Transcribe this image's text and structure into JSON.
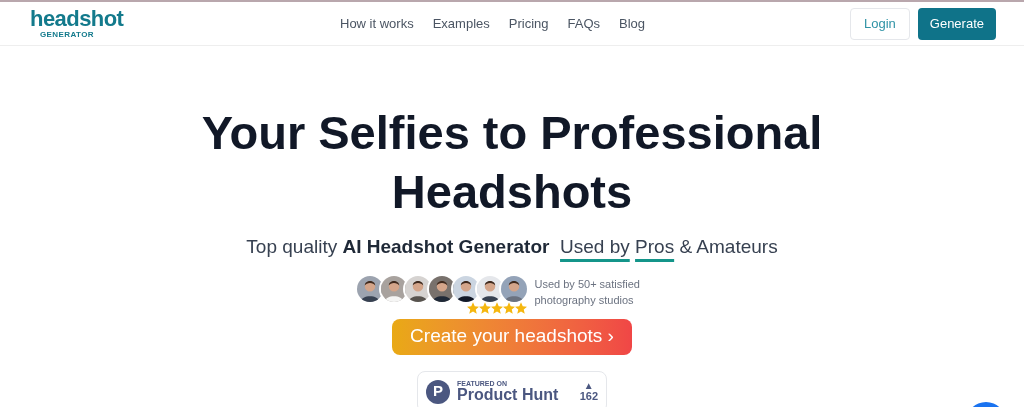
{
  "logo": {
    "wordmark": "headshot",
    "tagline": "GENERATOR"
  },
  "nav": [
    {
      "label": "How it works"
    },
    {
      "label": "Examples"
    },
    {
      "label": "Pricing"
    },
    {
      "label": "FAQs"
    },
    {
      "label": "Blog"
    }
  ],
  "login_button": "Login",
  "generate_button": "Generate",
  "heading": "Your Selfies to Professional Headshots",
  "subtitle": [
    {
      "text": "Top quality ",
      "kind": "plain"
    },
    {
      "text": "AI Headshot Generator",
      "kind": "bold"
    },
    {
      "text": "Used by",
      "kind": "underline"
    },
    {
      "text": "Pros",
      "kind": "underline"
    },
    {
      "text": " & Amateurs",
      "kind": "plain"
    }
  ],
  "social_proof": {
    "avatars": [
      {
        "kind": "picture"
      },
      {
        "kind": "picture"
      },
      {
        "kind": "picture"
      },
      {
        "kind": "picture"
      },
      {
        "kind": "picture"
      },
      {
        "kind": "picture"
      },
      {
        "kind": "picture"
      }
    ],
    "stars": 5,
    "text": "Used by 50+ satisfied photography studios"
  },
  "cta_button": "Create your headshots ›",
  "product_hunt": {
    "logo_letter": "P",
    "featured": "FEATURED ON",
    "name": "Product Hunt",
    "arrow": "▲",
    "votes": "162"
  }
}
